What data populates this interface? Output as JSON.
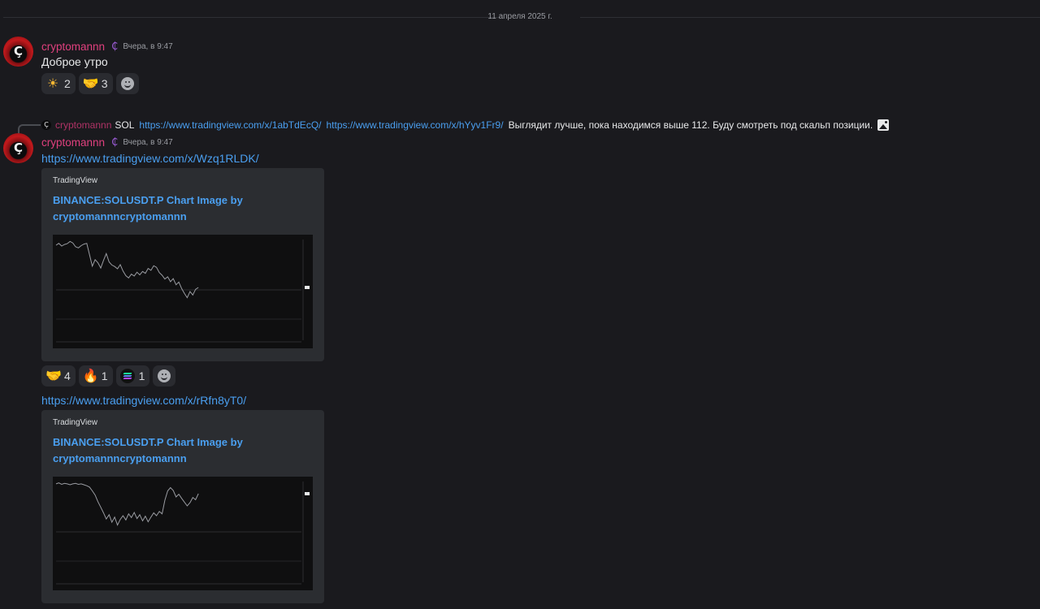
{
  "date_divider": "11 апреля 2025 г.",
  "messages": [
    {
      "avatar_glyph": "Ç",
      "username": "cryptomannn",
      "badge_icon": "₵",
      "timestamp": "Вчера, в 9:47",
      "text": "Доброе утро",
      "reactions": [
        {
          "icon": "sun-emoji",
          "emoji": "☀",
          "count": "2"
        },
        {
          "icon": "handshake-emoji",
          "emoji": "🤝",
          "count": "3"
        }
      ]
    },
    {
      "reply": {
        "avatar_glyph": "Ç",
        "username": "cryptomannn",
        "prefix": "SOL",
        "link1": "https://www.tradingview.com/x/1abTdEcQ/",
        "link2": "https://www.tradingview.com/x/hYyv1Fr9/",
        "text": "Выглядит лучше, пока находимся выше 112.  Буду смотреть под скальп позиции.",
        "attachment_icon": "image-icon"
      },
      "avatar_glyph": "Ç",
      "username": "cryptomannn",
      "badge_icon": "₵",
      "timestamp": "Вчера, в 9:47",
      "link": "https://www.tradingview.com/x/Wzq1RLDK/",
      "embed": {
        "provider": "TradingView",
        "title": "BINANCE:SOLUSDT.P Chart Image by cryptomannncryptomannn"
      },
      "reactions": [
        {
          "icon": "handshake-emoji",
          "emoji": "🤝",
          "count": "4"
        },
        {
          "icon": "fire-emoji",
          "emoji": "🔥",
          "count": "1"
        },
        {
          "icon": "solana-emoji",
          "emoji": "",
          "count": "1"
        }
      ]
    },
    {
      "link": "https://www.tradingview.com/x/rRfn8yT0/",
      "embed": {
        "provider": "TradingView",
        "title": "BINANCE:SOLUSDT.P Chart Image by cryptomannncryptomannn"
      }
    }
  ],
  "chart_data": [
    {
      "type": "line",
      "values": [
        120,
        120.5,
        119.8,
        120.2,
        120.4,
        121,
        120.6,
        119.6,
        119.3,
        119.9,
        120.3,
        120.5,
        117.5,
        114.5,
        116.2,
        115.4,
        114,
        116,
        117.8,
        115.6,
        114.8,
        114.4,
        113.8,
        114.9,
        113.2,
        112,
        111.4,
        112.4,
        111.9,
        112.9,
        112.2,
        113.1,
        112.6,
        113.9,
        113.4,
        114.6,
        114.2,
        112.8,
        112.1,
        111.1,
        111.7,
        110.4,
        111.2,
        109.6,
        110.3,
        108.6,
        107.3,
        106.2,
        107.8,
        106.9,
        108.4,
        108.9
      ],
      "colors": {
        "line": "#9a9ca2",
        "background": "#0f0f10"
      }
    },
    {
      "type": "line",
      "values": [
        121,
        121.2,
        120.9,
        121.1,
        121,
        120.8,
        121,
        121.1,
        120.9,
        121,
        120.8,
        120.6,
        120.3,
        119.5,
        118.6,
        117.2,
        116,
        114.8,
        113.5,
        114.4,
        112.8,
        113.9,
        112.2,
        113.4,
        114.2,
        113.3,
        114.6,
        113.8,
        114.9,
        113.6,
        114.4,
        113.1,
        114.1,
        112.9,
        113.9,
        114.8,
        114.2,
        115.1,
        114.6,
        117.5,
        119.5,
        120.2,
        119.6,
        118.2,
        118.8,
        117.9,
        117.1,
        116.3,
        117,
        118.1,
        117.6,
        118.9
      ]
    }
  ]
}
